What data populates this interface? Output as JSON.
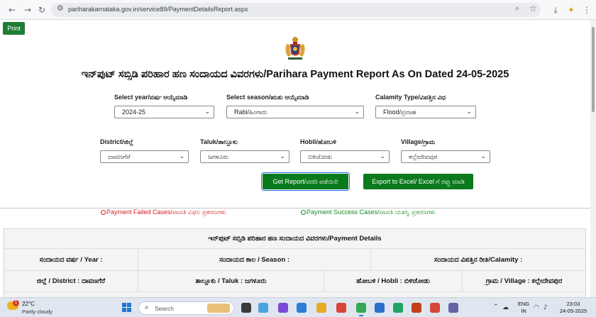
{
  "browser": {
    "url": "pariharakarnataka.gov.in/service89/PaymentDetailsReport.aspx"
  },
  "page": {
    "print_label": "Print",
    "title": "ಇನ್‌ಪುಟ್ ಸಬ್ಸಿಡಿ ಪರಿಹಾರ ಹಣ ಸಂದಾಯದ ವಿವರಗಳು/Parihara Payment Report As On Dated 24-05-2025"
  },
  "filters": {
    "year": {
      "label": "Select year/ವರ್ಷ ಆಯ್ಕೆಮಾಡಿ",
      "value": "2024-25"
    },
    "season": {
      "label": "Select season/ಋತು ಆಯ್ಕೆಮಾಡಿ",
      "value": "Rabi/ಹಿಂಗಾರು"
    },
    "calamity": {
      "label": "Calamity Type/ವಿಪತ್ತಿನ ವಿಧ",
      "value": "Flood/ಪ್ರವಾಹ"
    },
    "district": {
      "label": "District/ಜಿಲ್ಲೆ",
      "value": "ದಾವಣಗೆರೆ"
    },
    "taluk": {
      "label": "Taluk/ತಾಲ್ಲೂಕು",
      "value": "ಜಗಳೂರು"
    },
    "hobli": {
      "label": "Hobli/ಹೋಬಳಿ",
      "value": "ಬಿಳಿಚೋಡು"
    },
    "village": {
      "label": "Village/ಗ್ರಾಮ",
      "value": "ಕಲ್ಲೇದೇವಪುರ"
    }
  },
  "actions": {
    "get_report": "Get Report/ವರದಿ ಪಡೆಯಿರಿ",
    "export_excel": "Export to Excel/ Excel ಗೆ ರಫ್ತು ಮಾಡಿ"
  },
  "legend": {
    "failed": "Payment Failed Cases/ಪಾವತಿ ವಿಫಲ ಪ್ರಕರಣಗಳು",
    "success": "Payment Success Cases/ಪಾವತಿ ಯಶಸ್ವಿ ಪ್ರಕರಣಗಳು",
    "failed_color": "#d32222",
    "success_color": "#168a22"
  },
  "table": {
    "header": "ಇನ್‌ಪುಟ್ ಸಬ್ಸಿಡಿ ಪರಿಹಾರ ಹಣ ಸಂದಾಯದ ವಿವರಗಳು/Payment Details",
    "row1": [
      "ಸಂದಾಯದ ವರ್ಷ / Year :",
      "ಸಂದಾಯದ ಕಾಲ / Season :",
      "ಸಂದಾಯದ ವಿಪತ್ತಿನ ರೀತಿ/Calamity :"
    ],
    "row2": [
      "ಜಿಲ್ಲೆ / District : ದಾವಣಗೆರೆ",
      "ತಾಲ್ಲೂಕು / Taluk : ಜಗಳೂರು",
      "ಹೋಬಳಿ / Hobli : ಬಿಳಿಚೋಡು",
      "ಗ್ರಾಮ / Village : ಕಲ್ಲೇದೇವಪುರ"
    ]
  },
  "taskbar": {
    "weather_badge": "1",
    "temperature": "22°C",
    "condition": "Partly cloudy",
    "search_placeholder": "Search",
    "lang_top": "ENG",
    "lang_bottom": "IN",
    "time": "23:03",
    "date": "24-05-2025"
  }
}
